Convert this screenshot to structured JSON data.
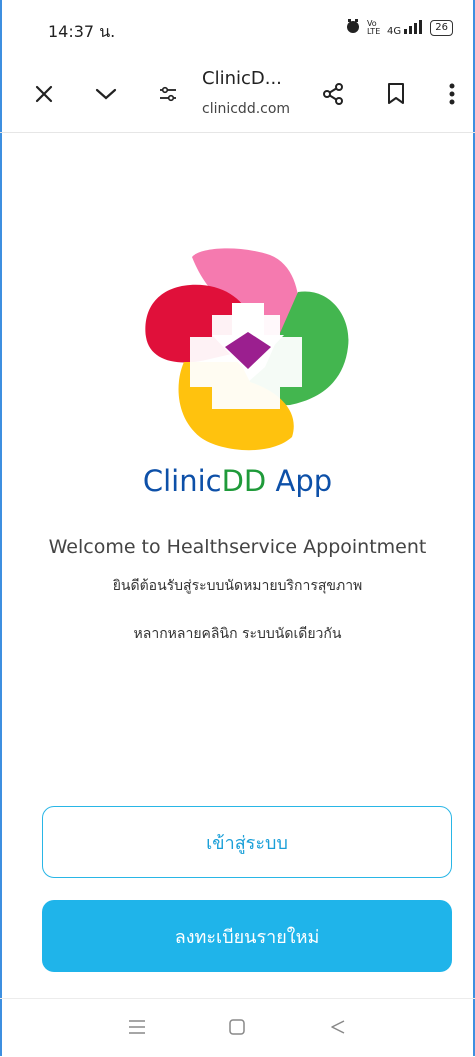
{
  "status_bar": {
    "time": "14:37 น.",
    "network": "4G",
    "volte": "Vo LTE",
    "battery": "26"
  },
  "toolbar": {
    "close_icon": "close-icon",
    "collapse_icon": "chevron-down-icon",
    "page_title": "ClinicD...",
    "url": "clinicdd.com",
    "share_icon": "share-icon",
    "bookmark_icon": "bookmark-icon",
    "menu_icon": "more-vertical-icon"
  },
  "app": {
    "name_part1": "Clinic",
    "name_part2": "DD",
    "name_part3": " App",
    "welcome_en": "Welcome to Healthservice Appointment",
    "welcome_th_1": "ยินดีต้อนรับสู่ระบบนัดหมายบริการสุขภาพ",
    "welcome_th_2": "หลากหลายคลินิก ระบบนัดเดียวกัน"
  },
  "buttons": {
    "login_label": "เข้าสู่ระบบ",
    "register_label": "ลงทะเบียนรายใหม่"
  },
  "colors": {
    "accent": "#1fb4ea",
    "title_blue": "#0d50a8",
    "title_green": "#1f9a3a",
    "logo_pink": "#f57aaf",
    "logo_red": "#e0103a",
    "logo_green": "#43b64f",
    "logo_yellow": "#ffc20e",
    "logo_purple": "#9b1f8f"
  },
  "nav": {
    "recent_icon": "recent-apps-icon",
    "home_icon": "home-icon",
    "back_icon": "back-icon"
  }
}
